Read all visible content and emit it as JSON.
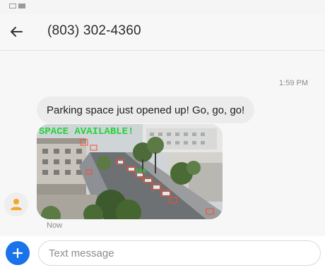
{
  "status_bar": {
    "icons": [
      "notification-icon",
      "image-notification-icon"
    ]
  },
  "header": {
    "back_icon": "arrow-left-icon",
    "contact": "(803) 302-4360"
  },
  "conversation": {
    "timestamp": "1:59 PM",
    "message_text": "Parking space just opened up! Go, go, go!",
    "image_overlay_text": "SPACE AVAILABLE!",
    "image_small_label": "CAR",
    "message_status": "Now",
    "avatar_icon": "person-icon"
  },
  "compose": {
    "add_icon": "plus-icon",
    "placeholder": "Text message"
  },
  "colors": {
    "accent": "#1a73e8",
    "avatar_icon": "#f5a623",
    "overlay_text": "#22d43a",
    "detection_boxes": "#ff4a2a"
  }
}
